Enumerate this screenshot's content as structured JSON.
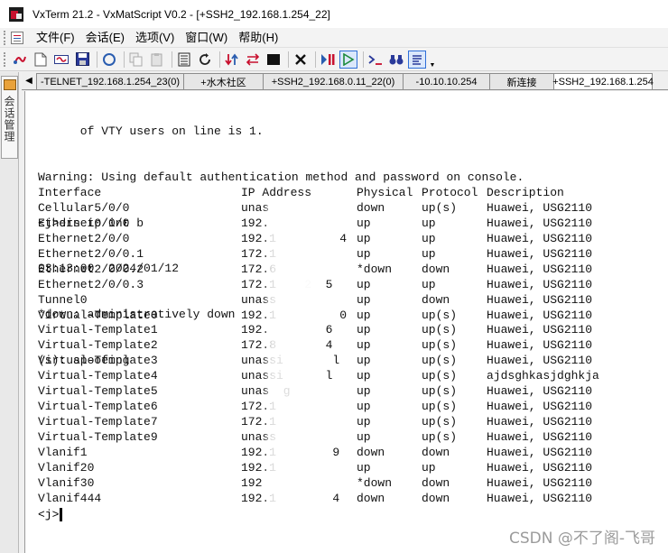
{
  "window": {
    "title": "VxTerm 21.2 - VxMatScript V0.2 - [+SSH2_192.168.1.254_22]"
  },
  "menu": {
    "items": [
      "文件(F)",
      "会话(E)",
      "选项(V)",
      "窗口(W)",
      "帮助(H)"
    ]
  },
  "toolbar": {
    "buttons": [
      "connect-icon",
      "new-session-icon",
      "reconnect-icon",
      "save-icon",
      "circle-icon",
      "copy-icon",
      "paste-icon",
      "list-icon",
      "refresh-icon",
      "transfer-icon",
      "red-arrows-icon",
      "stop-icon",
      "close-icon",
      "pause-icon",
      "play-icon",
      "prompt-icon",
      "binoculars-icon",
      "options-icon"
    ]
  },
  "side": {
    "label": "会话管理"
  },
  "tabs": [
    {
      "label": "-TELNET_192.168.1.254_23(0)"
    },
    {
      "label": "+水木社区"
    },
    {
      "label": "+SSH2_192.168.0.11_22(0)"
    },
    {
      "label": "-10.10.10.254"
    },
    {
      "label": "新连接"
    },
    {
      "label": "+SSH2_192.168.1.254"
    }
  ],
  "terminal": {
    "lines": [
      "      of VTY users on line is 1.",
      "Warning: Using default authentication method and password on console.",
      "<j>dis ip int b",
      "03:13:00  2024/01/12",
      "*down: administratively down",
      "(s): spoofing"
    ],
    "table": {
      "headers": [
        "Interface",
        "IP Address",
        "Physical",
        "Protocol",
        "Description"
      ],
      "rows": [
        [
          "Cellular5/0/0",
          "unas",
          "down",
          "up(s)",
          "Huawei, USG2110"
        ],
        [
          "Ethernet0/0/0",
          "192.",
          "up",
          "up",
          "Huawei, USG2110"
        ],
        [
          "Ethernet2/0/0",
          "192.1         4",
          "up",
          "up",
          "Huawei, USG2110"
        ],
        [
          "Ethernet2/0/0.1",
          "172.1",
          "up",
          "up",
          "Huawei, USG2110"
        ],
        [
          "Ethernet2/0/0.2",
          "172.6",
          "*down",
          "down",
          "Huawei, USG2110"
        ],
        [
          "Ethernet2/0/0.3",
          "172.1    2  5",
          "up",
          "up",
          "Huawei, USG2110"
        ],
        [
          "Tunnel0",
          "unass",
          "up",
          "down",
          "Huawei, USG2110"
        ],
        [
          "Virtual-Template0",
          "192.1         0",
          "up",
          "up(s)",
          "Huawei, USG2110"
        ],
        [
          "Virtual-Template1",
          "192.        6",
          "up",
          "up(s)",
          "Huawei, USG2110"
        ],
        [
          "Virtual-Template2",
          "172.8       4",
          "up",
          "up(s)",
          "Huawei, USG2110"
        ],
        [
          "Virtual-Template3",
          "unassi       l",
          "up",
          "up(s)",
          "Huawei, USG2110"
        ],
        [
          "Virtual-Template4",
          "unassi      l",
          "up",
          "up(s)",
          "ajdsghkasjdghkja"
        ],
        [
          "Virtual-Template5",
          "unas  g",
          "up",
          "up(s)",
          "Huawei, USG2110"
        ],
        [
          "Virtual-Template6",
          "172.1",
          "up",
          "up(s)",
          "Huawei, USG2110"
        ],
        [
          "Virtual-Template7",
          "172.1",
          "up",
          "up(s)",
          "Huawei, USG2110"
        ],
        [
          "Virtual-Template9",
          "unass",
          "up",
          "up(s)",
          "Huawei, USG2110"
        ],
        [
          "Vlanif1",
          "192.1        9",
          "down",
          "down",
          "Huawei, USG2110"
        ],
        [
          "Vlanif20",
          "192.1",
          "up",
          "up",
          "Huawei, USG2110"
        ],
        [
          "Vlanif30",
          "192",
          "*down",
          "down",
          "Huawei, USG2110"
        ],
        [
          "Vlanif444",
          "192.1        4",
          "down",
          "down",
          "Huawei, USG2110"
        ]
      ]
    },
    "prompt": "<j>"
  },
  "watermark": "CSDN @不了阁-飞哥",
  "colors": {
    "terminal_bg": "#ffffff",
    "terminal_text": "#111111",
    "active_tool_border": "#2f6fd8"
  }
}
